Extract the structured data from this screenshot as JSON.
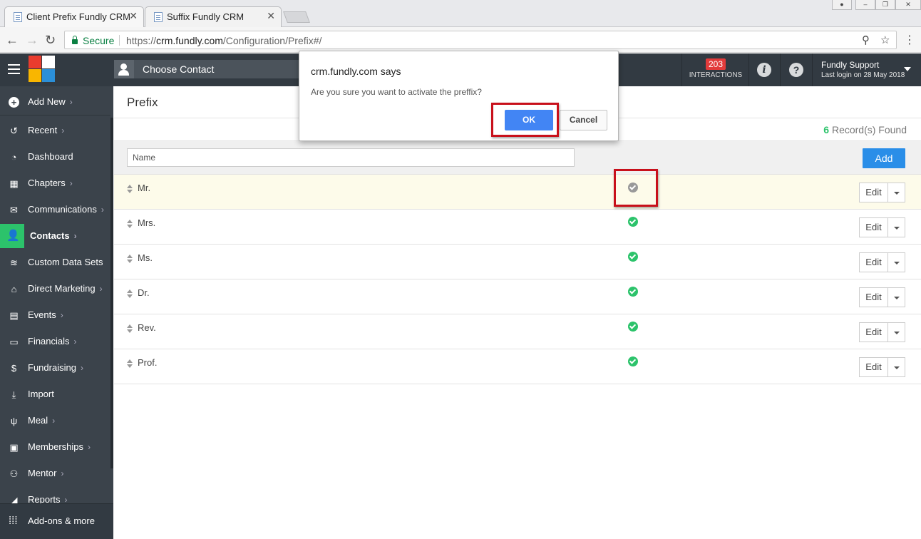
{
  "browser": {
    "tabs": [
      {
        "title": "Client Prefix Fundly CRM",
        "active": true
      },
      {
        "title": "Suffix Fundly CRM",
        "active": false
      }
    ],
    "secure_label": "Secure",
    "url_scheme": "https://",
    "url_host": "crm.fundly.com",
    "url_path": "/Configuration/Prefix#/"
  },
  "header": {
    "choose_contact": "Choose Contact",
    "interactions_count": "203",
    "interactions_label": "INTERACTIONS",
    "user_name": "Fundly Support",
    "last_login": "Last login on 28 May 2018"
  },
  "sidebar": {
    "add_new": "Add New",
    "items": [
      {
        "label": "Recent",
        "icon": "history-icon",
        "chevron": true
      },
      {
        "label": "Dashboard",
        "icon": "dashboard-icon",
        "chevron": false
      },
      {
        "label": "Chapters",
        "icon": "grid-icon",
        "chevron": true
      },
      {
        "label": "Communications",
        "icon": "envelope-icon",
        "chevron": true
      },
      {
        "label": "Contacts",
        "icon": "user-icon",
        "chevron": true
      },
      {
        "label": "Custom Data Sets",
        "icon": "layers-icon",
        "chevron": false
      },
      {
        "label": "Direct Marketing",
        "icon": "mailbox-icon",
        "chevron": true
      },
      {
        "label": "Events",
        "icon": "calendar-icon",
        "chevron": true
      },
      {
        "label": "Financials",
        "icon": "money-icon",
        "chevron": true
      },
      {
        "label": "Fundraising",
        "icon": "moneybag-icon",
        "chevron": true
      },
      {
        "label": "Import",
        "icon": "import-icon",
        "chevron": false
      },
      {
        "label": "Meal",
        "icon": "cutlery-icon",
        "chevron": true
      },
      {
        "label": "Memberships",
        "icon": "idcard-icon",
        "chevron": true
      },
      {
        "label": "Mentor",
        "icon": "mentor-icon",
        "chevron": true
      },
      {
        "label": "Reports",
        "icon": "chart-icon",
        "chevron": true
      }
    ],
    "addons": "Add-ons & more"
  },
  "page": {
    "title": "Prefix",
    "records_count": "6",
    "records_label": "Record(s) Found",
    "name_placeholder": "Name",
    "add_label": "Add",
    "edit_label": "Edit",
    "rows": [
      {
        "name": "Mr.",
        "active": false
      },
      {
        "name": "Mrs.",
        "active": true
      },
      {
        "name": "Ms.",
        "active": true
      },
      {
        "name": "Dr.",
        "active": true
      },
      {
        "name": "Rev.",
        "active": true
      },
      {
        "name": "Prof.",
        "active": true
      }
    ]
  },
  "dialog": {
    "title": "crm.fundly.com says",
    "message": "Are you sure you want to activate the preffix?",
    "ok": "OK",
    "cancel": "Cancel"
  },
  "colors": {
    "sidebar": "#3b434b",
    "header": "#323a42",
    "accent_green": "#2cc36b",
    "primary_blue": "#2a8ee8",
    "dialog_ok": "#4285f4",
    "highlight_red": "#c8101b",
    "badge_red": "#e23b3b"
  }
}
